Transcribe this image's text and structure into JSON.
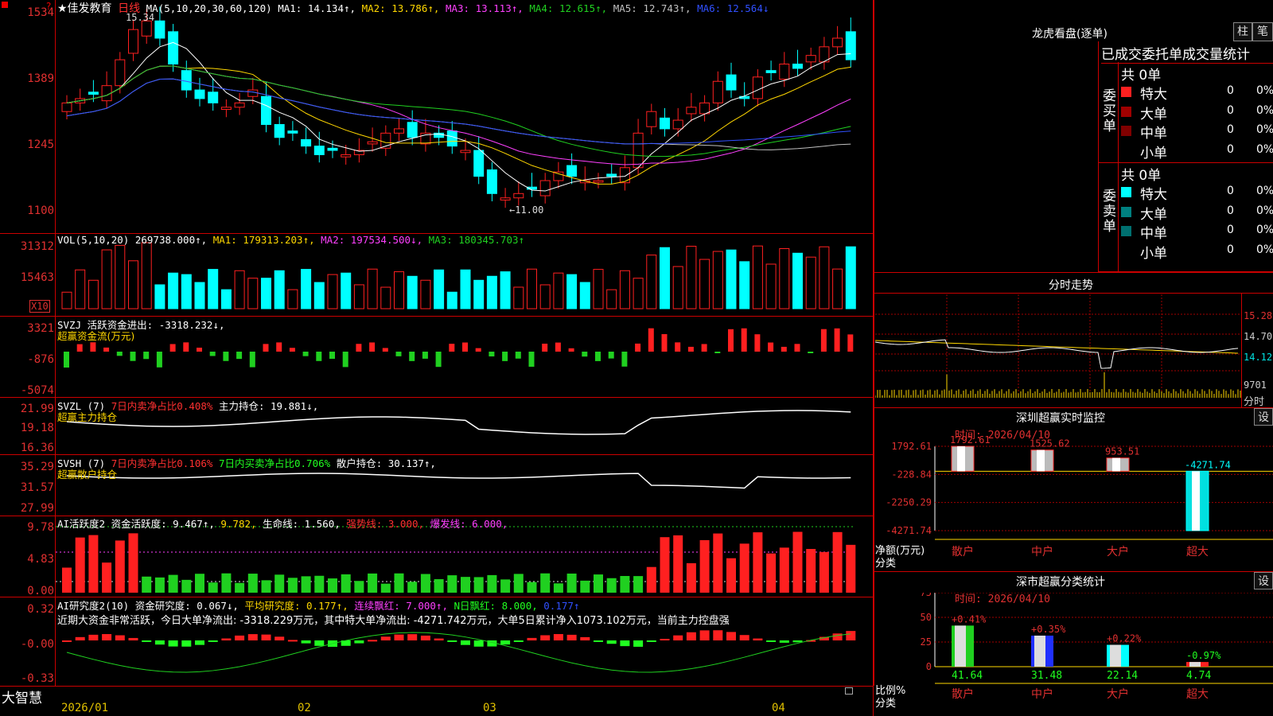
{
  "brand": "大智慧",
  "stock": {
    "name": "★佳发教育",
    "period": "日线"
  },
  "colors": {
    "up": "#ff2020",
    "down": "#00ffff",
    "ma1": "#ffffff",
    "ma2": "#ffd700",
    "ma3": "#ff40ff",
    "ma4": "#20d020",
    "ma5": "#c0c0c0",
    "ma6": "#3050ff",
    "axis": "#ff3030",
    "grid": "#aa0000"
  },
  "price_panel": {
    "ma_label": "MA(5,10,20,30,60,120)",
    "ma_values": [
      "MA1: 14.134↑,",
      "MA2: 13.786↑,",
      "MA3: 13.113↑,",
      "MA4: 12.615↑,",
      "MA5: 12.743↑,",
      "MA6: 12.564↓"
    ],
    "yticks": [
      "1534",
      "1389",
      "1245",
      "1100"
    ],
    "high_label": "15.34",
    "low_label": "←11.00"
  },
  "vol_panel": {
    "label": "VOL(5,10,20)",
    "value": "269738.000↑,",
    "ma": [
      "MA1: 179313.203↑,",
      "MA2: 197534.500↓,",
      "MA3: 180345.703↑"
    ],
    "yticks": [
      "31312",
      "15463"
    ],
    "unit": "X10"
  },
  "svzj_panel": {
    "title": "SVZJ",
    "line1": "活跃资金进出: -3318.232↓,",
    "line2": "超赢资金流(万元)",
    "yticks": [
      "3321",
      "-876",
      "-5074"
    ]
  },
  "svzl_panel": {
    "title": "SVZL (7)",
    "line1": "7日内卖净占比0.408%",
    "line1b": "主力持仓: 19.881↓,",
    "line2": "超赢主力持仓",
    "yticks": [
      "21.99",
      "19.18",
      "16.36"
    ]
  },
  "svsh_panel": {
    "title": "SVSH (7)",
    "line1": "7日内卖净占比0.106%",
    "line1b": "7日内买卖净占比0.706%",
    "line1c": "散户持仓: 30.137↑,",
    "line2": "超赢散户持仓",
    "yticks": [
      "35.29",
      "31.57",
      "27.99"
    ]
  },
  "ai_active_panel": {
    "title": "AI活跃度2",
    "line1": "资金活跃度: 9.467↑,",
    "line1b": "9.782,",
    "line1c": "生命线: 1.560,",
    "line1d": "强势线: 3.000,",
    "line1e": "爆发线: 6.000,",
    "yticks": [
      "9.78",
      "4.83",
      "0.00"
    ]
  },
  "ai_research_panel": {
    "title": "AI研究度2(10)",
    "line1": "资金研究度: 0.067↓,",
    "line1b": "平均研究度: 0.177↑,",
    "line1c": "连续飘红: 7.000↑,",
    "line1d": "N日飘红: 8.000,",
    "line1e": "0.177↑",
    "note": "近期大资金非常活跃，今日大单净流出: -3318.229万元，其中特大单净流出: -4271.742万元，大单5日累计净入1073.102万元，当前主力控盘强",
    "yticks": [
      "0.32",
      "-0.00",
      "-0.33"
    ]
  },
  "xaxis": {
    "labels": [
      "2026/01",
      "02",
      "03",
      "04"
    ]
  },
  "lhb": {
    "title": "龙虎看盘(逐单)",
    "btn_bar": "柱",
    "btn_pen": "笔",
    "tabs": "已成交委托单成交量统计",
    "buy_label": "委买单",
    "sell_label": "委卖单",
    "buy_total": "共 0单",
    "sell_total": "共 0单",
    "rows": [
      {
        "name": "特大",
        "count": "0",
        "pct": "0%"
      },
      {
        "name": "大单",
        "count": "0",
        "pct": "0%"
      },
      {
        "name": "中单",
        "count": "0",
        "pct": "0%"
      },
      {
        "name": "小单",
        "count": "0",
        "pct": "0%"
      }
    ]
  },
  "intraday": {
    "title": "分时走势",
    "yticks": [
      "15.28",
      "14.70",
      "14.12",
      "9701"
    ],
    "foot": "分时"
  },
  "sz_monitor": {
    "title": "深圳超赢实时监控",
    "btn": "设",
    "time": "时间: 2026/04/10",
    "yticks": [
      "1792.61",
      "-228.84",
      "-2250.29",
      "-4271.74"
    ],
    "ylabel1": "净额(万元)",
    "ylabel2": "分类",
    "categories": [
      "散户",
      "中户",
      "大户",
      "超大"
    ],
    "values": [
      1792.61,
      1525.62,
      953.51,
      -4271.74
    ],
    "value_labels": [
      "1792.61",
      "1525.62",
      "953.51",
      "-4271.74"
    ]
  },
  "sz_class": {
    "title": "深市超赢分类统计",
    "btn": "设",
    "time": "时间: 2026/04/10",
    "yticks": [
      "75",
      "50",
      "25",
      "0"
    ],
    "ylabel1": "比例%",
    "ylabel2": "分类",
    "categories": [
      "散户",
      "中户",
      "大户",
      "超大"
    ],
    "values": [
      41.64,
      31.48,
      22.14,
      4.74
    ],
    "value_labels": [
      "41.64",
      "31.48",
      "22.14",
      "4.74"
    ],
    "changes": [
      "+0.41%",
      "+0.35%",
      "+0.22%",
      "-0.97%"
    ]
  },
  "chart_data": [
    {
      "type": "bar",
      "title": "深圳超赢实时监控",
      "ylabel": "净额(万元)",
      "categories": [
        "散户",
        "中户",
        "大户",
        "超大"
      ],
      "values": [
        1792.61,
        1525.62,
        953.51,
        -4271.74
      ],
      "ylim": [
        -4271.74,
        1792.61
      ]
    },
    {
      "type": "bar",
      "title": "深市超赢分类统计",
      "ylabel": "比例%",
      "categories": [
        "散户",
        "中户",
        "大户",
        "超大"
      ],
      "values": [
        41.64,
        31.48,
        22.14,
        4.74
      ],
      "ylim": [
        0,
        75
      ]
    }
  ]
}
